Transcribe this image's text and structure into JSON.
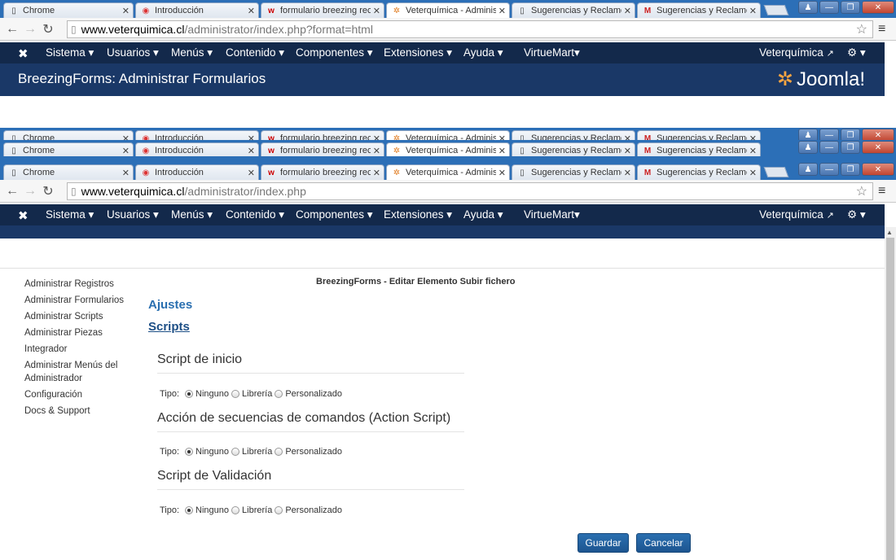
{
  "browser": {
    "tabs": [
      {
        "label": "Chrome",
        "icon": "page-icon"
      },
      {
        "label": "Introducción",
        "icon": "chrome-icon"
      },
      {
        "label": "formulario breezing rec",
        "icon": "w-icon"
      },
      {
        "label": "Veterquímica - Adminis",
        "icon": "joomla-icon"
      },
      {
        "label": "Sugerencias y Reclamos",
        "icon": "page-icon"
      },
      {
        "label": "Sugerencias y Reclamos",
        "icon": "gmail-icon"
      }
    ],
    "url1_host": "www.veterquimica.cl",
    "url1_path": "/administrator/index.php?format=html",
    "url2_host": "www.veterquimica.cl",
    "url2_path": "/administrator/index.php"
  },
  "nav": {
    "items": [
      "Sistema ▾",
      "Usuarios ▾",
      "Menús ▾",
      "Contenido ▾",
      "Componentes ▾",
      "Extensiones ▾",
      "Ayuda ▾",
      "VirtueMart▾"
    ],
    "site_link": "Veterquímica",
    "gear": "▾"
  },
  "header": {
    "title": "BreezingForms: Administrar Formularios",
    "logo_text": "Joomla!"
  },
  "sidebar": {
    "items": [
      "Administrar Registros",
      "Administrar Formularios",
      "Administrar Scripts",
      "Administrar Piezas",
      "Integrador",
      "Administrar Menús del Administrador",
      "Configuración",
      "Docs & Support"
    ]
  },
  "main": {
    "page_heading": "BreezingForms - Editar Elemento Subir fichero",
    "tab_ajustes": "Ajustes",
    "tab_scripts": "Scripts",
    "sections": [
      {
        "title": "Script de inicio"
      },
      {
        "title": "Acción de secuencias de comandos (Action Script)"
      },
      {
        "title": "Script de Validación"
      }
    ],
    "tipo_label": "Tipo:",
    "options": [
      "Ninguno",
      "Librería",
      "Personalizado"
    ],
    "save_button": "Guardar",
    "cancel_button": "Cancelar"
  },
  "colors": {
    "nav_bg": "#13294b",
    "header_bg": "#1a3867",
    "link_blue": "#2a6fb0",
    "tabstrip_bg": "#2c6fb7"
  }
}
